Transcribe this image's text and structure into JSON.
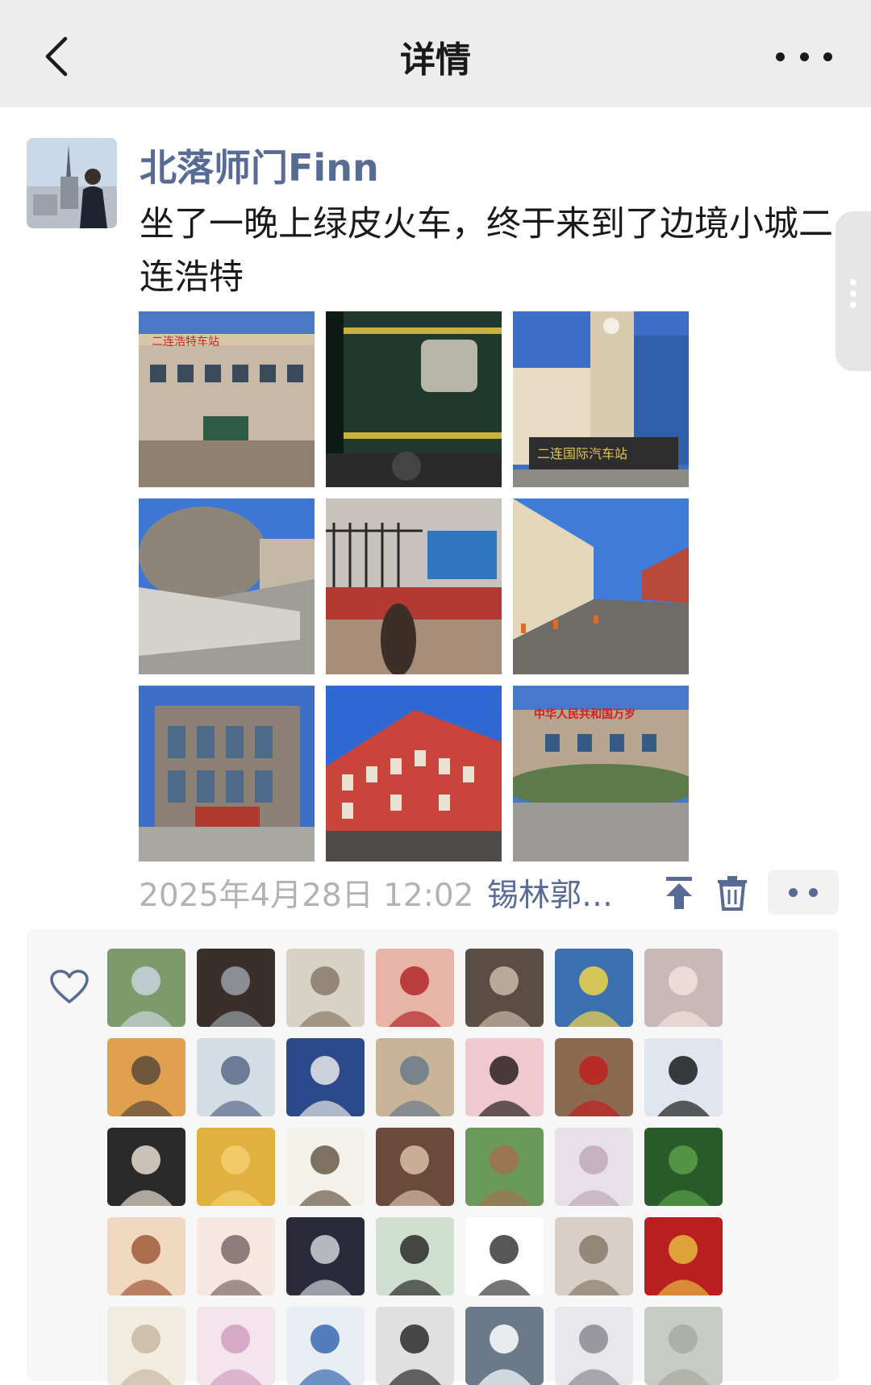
{
  "nav": {
    "title": "详情",
    "back_icon": "chevron-left-icon",
    "more_icon": "ellipsis-icon"
  },
  "post": {
    "author": "北落师门Finn",
    "text": "坐了一晚上绿皮火车，终于来到了边境小城二连浩特",
    "timestamp": "2025年4月28日 12:02",
    "location": "锡林郭…",
    "photo_count": 9
  },
  "photos": [
    {
      "desc_icon": "building-photo",
      "sign": "二连浩特车站"
    },
    {
      "desc_icon": "train-car-photo",
      "sign": ""
    },
    {
      "desc_icon": "bus-station-photo",
      "sign": "二连国际汽车站"
    },
    {
      "desc_icon": "rock-monument-photo",
      "sign": ""
    },
    {
      "desc_icon": "fence-shadow-photo",
      "sign": ""
    },
    {
      "desc_icon": "street-photo",
      "sign": ""
    },
    {
      "desc_icon": "grey-building-photo",
      "sign": ""
    },
    {
      "desc_icon": "red-building-photo",
      "sign": ""
    },
    {
      "desc_icon": "government-building-photo",
      "sign": "中华人民共和国万岁"
    }
  ],
  "actions": {
    "pin_icon": "pin-to-top-icon",
    "delete_icon": "trash-icon",
    "more_icon": "comment-more-icon"
  },
  "likes": {
    "heart_icon": "heart-outline-icon",
    "avatar_count": 35
  },
  "colors": {
    "link_blue": "#576b95",
    "nav_bg": "#ededed",
    "likes_bg": "#f7f7f7"
  }
}
